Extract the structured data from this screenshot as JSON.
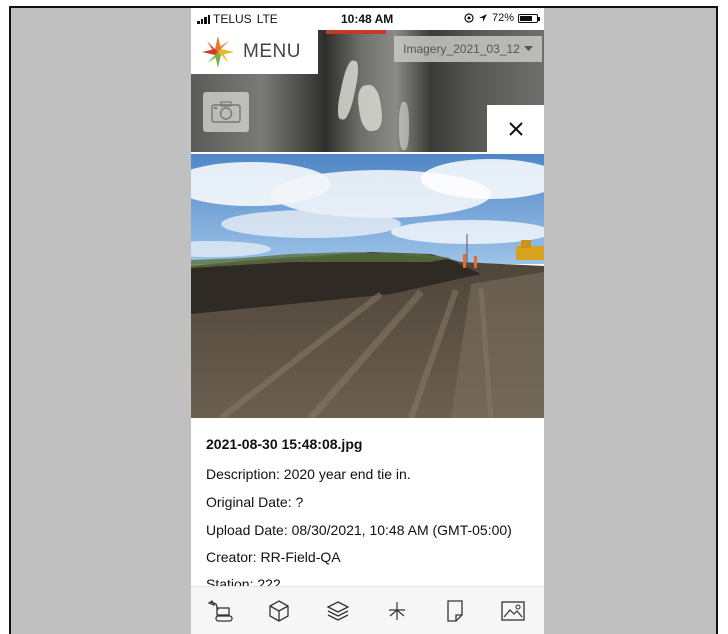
{
  "status_bar": {
    "carrier": "TELUS",
    "network": "LTE",
    "time": "10:48 AM",
    "battery": "72%",
    "battery_level": 0.72
  },
  "map": {
    "menu_label": "MENU",
    "imagery_selected": "Imagery_2021_03_12",
    "icons": [
      "logo-icon",
      "camera-icon",
      "close-icon",
      "chevron-down-icon"
    ]
  },
  "photo": {
    "filename": "2021-08-30 15:48:08.jpg",
    "description": "Description: 2020 year end tie in.",
    "original_date": "Original Date: ?",
    "upload_date": "Upload Date: 08/30/2021, 10:48 AM (GMT-05:00)",
    "creator": "Creator: RR-Field-QA",
    "station": "Station: 222"
  },
  "toolbar": {
    "icons": [
      "excavator-icon",
      "cube-icon",
      "layers-icon",
      "measure-icon",
      "document-icon",
      "image-icon"
    ]
  },
  "colors": {
    "logo_orange": "#e8752a",
    "logo_red": "#d23a2a",
    "logo_yellow": "#e8b923",
    "logo_green": "#7cb342"
  }
}
